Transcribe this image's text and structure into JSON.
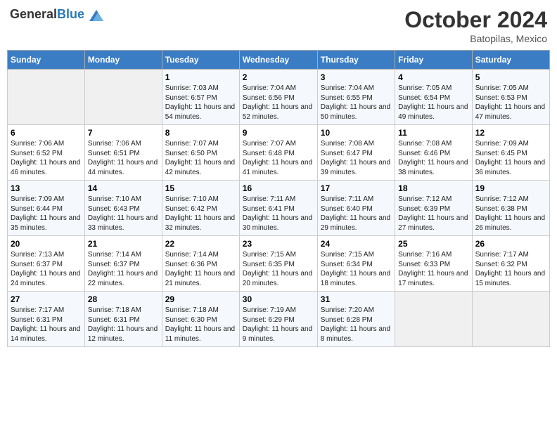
{
  "logo": {
    "general": "General",
    "blue": "Blue"
  },
  "title": "October 2024",
  "location": "Batopilas, Mexico",
  "days_header": [
    "Sunday",
    "Monday",
    "Tuesday",
    "Wednesday",
    "Thursday",
    "Friday",
    "Saturday"
  ],
  "weeks": [
    [
      {
        "day": "",
        "sunrise": "",
        "sunset": "",
        "daylight": ""
      },
      {
        "day": "",
        "sunrise": "",
        "sunset": "",
        "daylight": ""
      },
      {
        "day": "1",
        "sunrise": "Sunrise: 7:03 AM",
        "sunset": "Sunset: 6:57 PM",
        "daylight": "Daylight: 11 hours and 54 minutes."
      },
      {
        "day": "2",
        "sunrise": "Sunrise: 7:04 AM",
        "sunset": "Sunset: 6:56 PM",
        "daylight": "Daylight: 11 hours and 52 minutes."
      },
      {
        "day": "3",
        "sunrise": "Sunrise: 7:04 AM",
        "sunset": "Sunset: 6:55 PM",
        "daylight": "Daylight: 11 hours and 50 minutes."
      },
      {
        "day": "4",
        "sunrise": "Sunrise: 7:05 AM",
        "sunset": "Sunset: 6:54 PM",
        "daylight": "Daylight: 11 hours and 49 minutes."
      },
      {
        "day": "5",
        "sunrise": "Sunrise: 7:05 AM",
        "sunset": "Sunset: 6:53 PM",
        "daylight": "Daylight: 11 hours and 47 minutes."
      }
    ],
    [
      {
        "day": "6",
        "sunrise": "Sunrise: 7:06 AM",
        "sunset": "Sunset: 6:52 PM",
        "daylight": "Daylight: 11 hours and 46 minutes."
      },
      {
        "day": "7",
        "sunrise": "Sunrise: 7:06 AM",
        "sunset": "Sunset: 6:51 PM",
        "daylight": "Daylight: 11 hours and 44 minutes."
      },
      {
        "day": "8",
        "sunrise": "Sunrise: 7:07 AM",
        "sunset": "Sunset: 6:50 PM",
        "daylight": "Daylight: 11 hours and 42 minutes."
      },
      {
        "day": "9",
        "sunrise": "Sunrise: 7:07 AM",
        "sunset": "Sunset: 6:48 PM",
        "daylight": "Daylight: 11 hours and 41 minutes."
      },
      {
        "day": "10",
        "sunrise": "Sunrise: 7:08 AM",
        "sunset": "Sunset: 6:47 PM",
        "daylight": "Daylight: 11 hours and 39 minutes."
      },
      {
        "day": "11",
        "sunrise": "Sunrise: 7:08 AM",
        "sunset": "Sunset: 6:46 PM",
        "daylight": "Daylight: 11 hours and 38 minutes."
      },
      {
        "day": "12",
        "sunrise": "Sunrise: 7:09 AM",
        "sunset": "Sunset: 6:45 PM",
        "daylight": "Daylight: 11 hours and 36 minutes."
      }
    ],
    [
      {
        "day": "13",
        "sunrise": "Sunrise: 7:09 AM",
        "sunset": "Sunset: 6:44 PM",
        "daylight": "Daylight: 11 hours and 35 minutes."
      },
      {
        "day": "14",
        "sunrise": "Sunrise: 7:10 AM",
        "sunset": "Sunset: 6:43 PM",
        "daylight": "Daylight: 11 hours and 33 minutes."
      },
      {
        "day": "15",
        "sunrise": "Sunrise: 7:10 AM",
        "sunset": "Sunset: 6:42 PM",
        "daylight": "Daylight: 11 hours and 32 minutes."
      },
      {
        "day": "16",
        "sunrise": "Sunrise: 7:11 AM",
        "sunset": "Sunset: 6:41 PM",
        "daylight": "Daylight: 11 hours and 30 minutes."
      },
      {
        "day": "17",
        "sunrise": "Sunrise: 7:11 AM",
        "sunset": "Sunset: 6:40 PM",
        "daylight": "Daylight: 11 hours and 29 minutes."
      },
      {
        "day": "18",
        "sunrise": "Sunrise: 7:12 AM",
        "sunset": "Sunset: 6:39 PM",
        "daylight": "Daylight: 11 hours and 27 minutes."
      },
      {
        "day": "19",
        "sunrise": "Sunrise: 7:12 AM",
        "sunset": "Sunset: 6:38 PM",
        "daylight": "Daylight: 11 hours and 26 minutes."
      }
    ],
    [
      {
        "day": "20",
        "sunrise": "Sunrise: 7:13 AM",
        "sunset": "Sunset: 6:37 PM",
        "daylight": "Daylight: 11 hours and 24 minutes."
      },
      {
        "day": "21",
        "sunrise": "Sunrise: 7:14 AM",
        "sunset": "Sunset: 6:37 PM",
        "daylight": "Daylight: 11 hours and 22 minutes."
      },
      {
        "day": "22",
        "sunrise": "Sunrise: 7:14 AM",
        "sunset": "Sunset: 6:36 PM",
        "daylight": "Daylight: 11 hours and 21 minutes."
      },
      {
        "day": "23",
        "sunrise": "Sunrise: 7:15 AM",
        "sunset": "Sunset: 6:35 PM",
        "daylight": "Daylight: 11 hours and 20 minutes."
      },
      {
        "day": "24",
        "sunrise": "Sunrise: 7:15 AM",
        "sunset": "Sunset: 6:34 PM",
        "daylight": "Daylight: 11 hours and 18 minutes."
      },
      {
        "day": "25",
        "sunrise": "Sunrise: 7:16 AM",
        "sunset": "Sunset: 6:33 PM",
        "daylight": "Daylight: 11 hours and 17 minutes."
      },
      {
        "day": "26",
        "sunrise": "Sunrise: 7:17 AM",
        "sunset": "Sunset: 6:32 PM",
        "daylight": "Daylight: 11 hours and 15 minutes."
      }
    ],
    [
      {
        "day": "27",
        "sunrise": "Sunrise: 7:17 AM",
        "sunset": "Sunset: 6:31 PM",
        "daylight": "Daylight: 11 hours and 14 minutes."
      },
      {
        "day": "28",
        "sunrise": "Sunrise: 7:18 AM",
        "sunset": "Sunset: 6:31 PM",
        "daylight": "Daylight: 11 hours and 12 minutes."
      },
      {
        "day": "29",
        "sunrise": "Sunrise: 7:18 AM",
        "sunset": "Sunset: 6:30 PM",
        "daylight": "Daylight: 11 hours and 11 minutes."
      },
      {
        "day": "30",
        "sunrise": "Sunrise: 7:19 AM",
        "sunset": "Sunset: 6:29 PM",
        "daylight": "Daylight: 11 hours and 9 minutes."
      },
      {
        "day": "31",
        "sunrise": "Sunrise: 7:20 AM",
        "sunset": "Sunset: 6:28 PM",
        "daylight": "Daylight: 11 hours and 8 minutes."
      },
      {
        "day": "",
        "sunrise": "",
        "sunset": "",
        "daylight": ""
      },
      {
        "day": "",
        "sunrise": "",
        "sunset": "",
        "daylight": ""
      }
    ]
  ]
}
